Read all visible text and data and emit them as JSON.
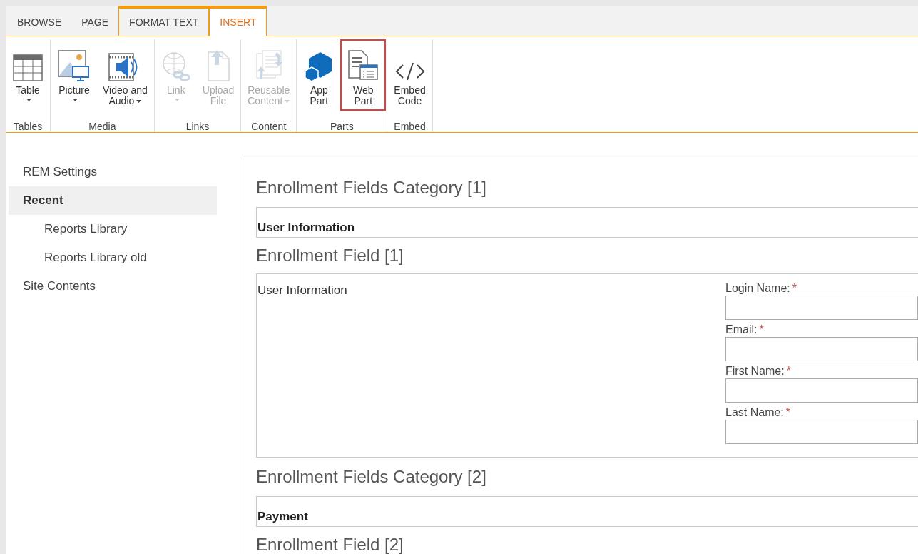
{
  "tabs": [
    {
      "label": "BROWSE",
      "selected": false,
      "contextual": false
    },
    {
      "label": "PAGE",
      "selected": false,
      "contextual": false
    },
    {
      "label": "FORMAT TEXT",
      "selected": false,
      "contextual": true
    },
    {
      "label": "INSERT",
      "selected": true,
      "contextual": true
    }
  ],
  "ribbon": {
    "groups": [
      {
        "label": "Tables",
        "buttons": [
          {
            "kind": "table",
            "lines": [
              "Table"
            ],
            "dropdown": true,
            "disabled": false,
            "highlighted": false
          }
        ]
      },
      {
        "label": "Media",
        "buttons": [
          {
            "kind": "picture",
            "lines": [
              "Picture"
            ],
            "dropdown": true,
            "disabled": false,
            "highlighted": false
          },
          {
            "kind": "video",
            "lines": [
              "Video and",
              "Audio"
            ],
            "dropdown": true,
            "disabled": false,
            "highlighted": false
          }
        ]
      },
      {
        "label": "Links",
        "buttons": [
          {
            "kind": "link",
            "lines": [
              "Link"
            ],
            "dropdown": true,
            "disabled": true,
            "highlighted": false
          },
          {
            "kind": "upload",
            "lines": [
              "Upload",
              "File"
            ],
            "dropdown": false,
            "disabled": true,
            "highlighted": false
          }
        ]
      },
      {
        "label": "Content",
        "buttons": [
          {
            "kind": "reusable",
            "lines": [
              "Reusable",
              "Content"
            ],
            "dropdown": true,
            "disabled": true,
            "highlighted": false
          }
        ]
      },
      {
        "label": "Parts",
        "buttons": [
          {
            "kind": "app",
            "lines": [
              "App",
              "Part"
            ],
            "dropdown": false,
            "disabled": false,
            "highlighted": false
          },
          {
            "kind": "webpart",
            "lines": [
              "Web",
              "Part"
            ],
            "dropdown": false,
            "disabled": false,
            "highlighted": true
          }
        ]
      },
      {
        "label": "Embed",
        "buttons": [
          {
            "kind": "embed",
            "lines": [
              "Embed",
              "Code"
            ],
            "dropdown": false,
            "disabled": false,
            "highlighted": false
          }
        ]
      }
    ]
  },
  "sidebar": {
    "items": [
      {
        "label": "REM Settings",
        "selected": false
      },
      {
        "label": "Recent",
        "selected": true,
        "children": [
          {
            "label": "Reports Library",
            "selected": false
          },
          {
            "label": "Reports Library old",
            "selected": false
          }
        ]
      },
      {
        "label": "Site Contents",
        "selected": false
      }
    ]
  },
  "content": {
    "sections": [
      {
        "kind": "heading",
        "text": "Enrollment Fields Category [1]"
      },
      {
        "kind": "category",
        "text": "User Information"
      },
      {
        "kind": "heading",
        "text": "Enrollment Field [1]"
      },
      {
        "kind": "form",
        "text": "User Information",
        "fields": [
          {
            "label": "Login Name:",
            "required": "*"
          },
          {
            "label": "Email:",
            "required": "*"
          },
          {
            "label": "First Name:",
            "required": "*"
          },
          {
            "label": "Last Name:",
            "required": "*"
          }
        ]
      },
      {
        "kind": "heading",
        "text": "Enrollment Fields Category [2]"
      },
      {
        "kind": "category",
        "text": "Payment"
      },
      {
        "kind": "heading",
        "text": "Enrollment Field [2]"
      }
    ]
  }
}
